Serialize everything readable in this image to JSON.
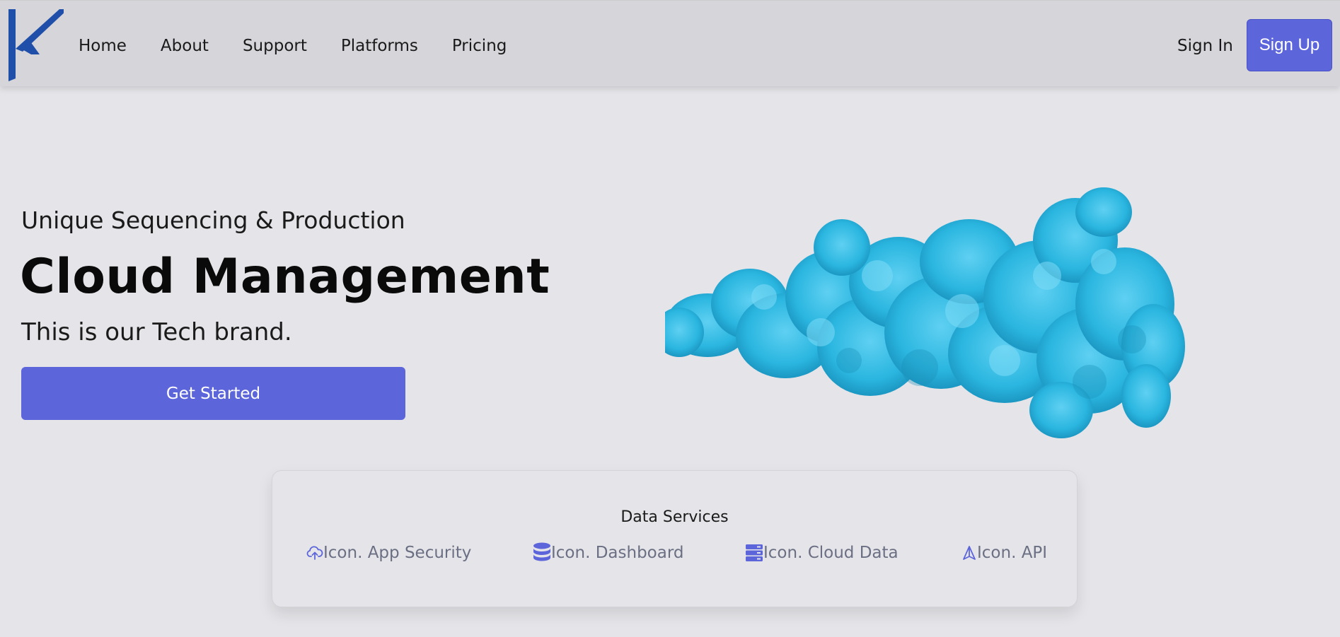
{
  "nav": {
    "links": [
      "Home",
      "About",
      "Support",
      "Platforms",
      "Pricing"
    ],
    "sign_in": "Sign In",
    "sign_up": "Sign Up"
  },
  "hero": {
    "eyebrow": "Unique Sequencing & Production",
    "title": "Cloud Management",
    "subtitle": "This is our Tech brand.",
    "cta": "Get Started",
    "image_icon": "blue-smoke-cloud"
  },
  "services": {
    "title": "Data Services",
    "items": [
      {
        "label": "Icon. App Security",
        "icon": "cloud-upload-icon"
      },
      {
        "label": "Icon. Dashboard",
        "icon": "database-icon"
      },
      {
        "label": "Icon. Cloud Data",
        "icon": "server-icon"
      },
      {
        "label": "Icon. API",
        "icon": "navigation-icon"
      }
    ]
  },
  "colors": {
    "accent": "#5d65db",
    "logo": "#1f4fa8",
    "navbar_bg": "#d6d5da",
    "page_bg": "#e5e5e9",
    "smoke": "#2ab6e0"
  }
}
